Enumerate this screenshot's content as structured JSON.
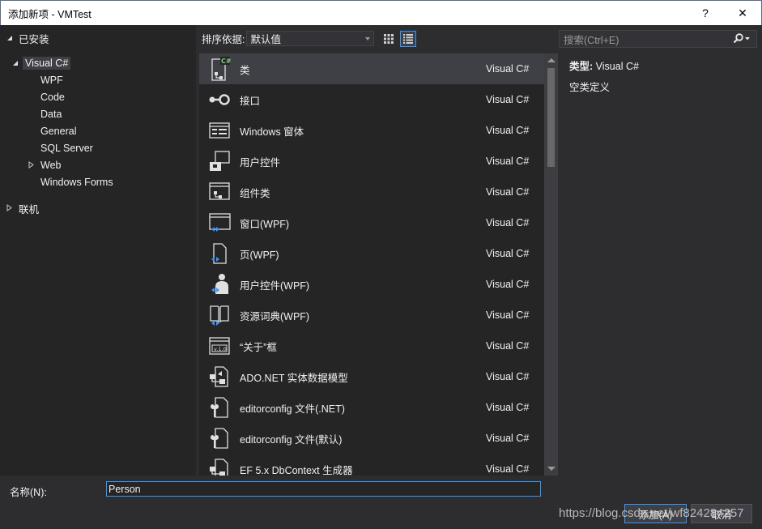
{
  "window": {
    "title": "添加新项 - VMTest",
    "help_label": "?",
    "close_label": "✕"
  },
  "tree": {
    "installed": "已安装",
    "visual_csharp": "Visual C#",
    "children": [
      "WPF",
      "Code",
      "Data",
      "General",
      "SQL Server",
      "Web",
      "Windows Forms"
    ],
    "online": "联机"
  },
  "toolbar": {
    "sort_label": "排序依据:",
    "sort_value": "默认值"
  },
  "search": {
    "placeholder": "搜索(Ctrl+E)"
  },
  "templates": [
    {
      "name": "类",
      "lang": "Visual C#",
      "icon": "class-icon"
    },
    {
      "name": "接口",
      "lang": "Visual C#",
      "icon": "interface-icon"
    },
    {
      "name": "Windows 窗体",
      "lang": "Visual C#",
      "icon": "windows-form-icon"
    },
    {
      "name": "用户控件",
      "lang": "Visual C#",
      "icon": "user-control-icon"
    },
    {
      "name": "组件类",
      "lang": "Visual C#",
      "icon": "component-class-icon"
    },
    {
      "name": "窗口(WPF)",
      "lang": "Visual C#",
      "icon": "wpf-window-icon"
    },
    {
      "name": "页(WPF)",
      "lang": "Visual C#",
      "icon": "wpf-page-icon"
    },
    {
      "name": "用户控件(WPF)",
      "lang": "Visual C#",
      "icon": "wpf-user-control-icon"
    },
    {
      "name": "资源词典(WPF)",
      "lang": "Visual C#",
      "icon": "resource-dictionary-icon"
    },
    {
      "name": "“关于”框",
      "lang": "Visual C#",
      "icon": "about-box-icon"
    },
    {
      "name": "ADO.NET 实体数据模型",
      "lang": "Visual C#",
      "icon": "entity-data-model-icon"
    },
    {
      "name": "editorconfig 文件(.NET)",
      "lang": "Visual C#",
      "icon": "editorconfig-icon"
    },
    {
      "name": "editorconfig 文件(默认)",
      "lang": "Visual C#",
      "icon": "editorconfig-icon"
    },
    {
      "name": "EF 5.x DbContext 生成器",
      "lang": "Visual C#",
      "icon": "dbcontext-generator-icon"
    }
  ],
  "info": {
    "type_label": "类型:",
    "type_value": "Visual C#",
    "description": "空类定义"
  },
  "bottom": {
    "name_label": "名称(N):",
    "name_value": "Person",
    "add_label": "添加(A)",
    "cancel_label": "取消"
  },
  "watermark": "https://blog.csdn.net/wf824284257",
  "colors": {
    "background": "#2d2d30",
    "panel": "#252526",
    "selection": "#3f3f46",
    "accent": "#3399ff",
    "text": "#f1f1f1"
  }
}
